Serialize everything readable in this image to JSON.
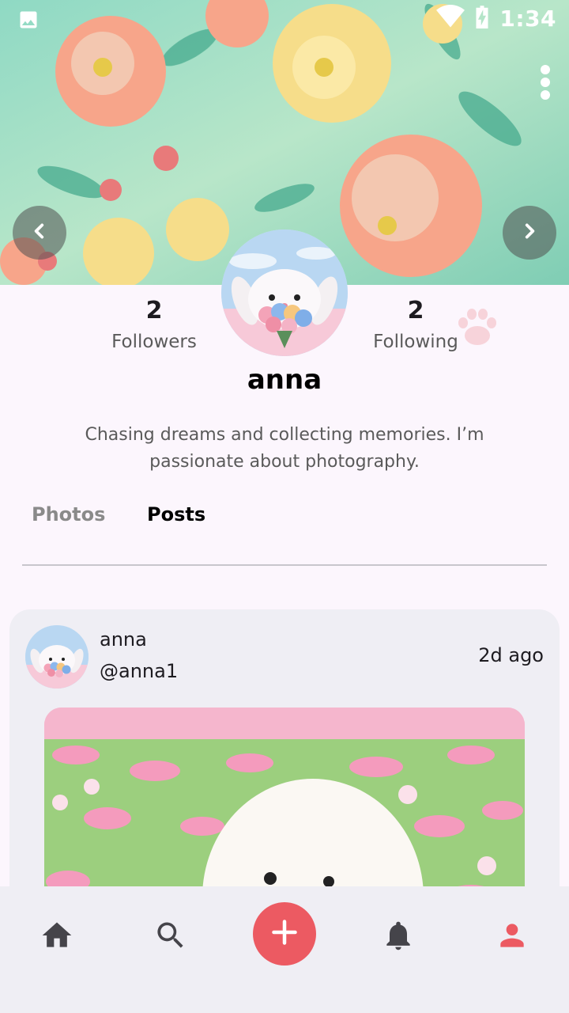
{
  "status_bar": {
    "time": "1:34",
    "icons": [
      "image-icon",
      "wifi-icon",
      "battery-charging-icon"
    ]
  },
  "cover": {
    "prev_icon": "chevron-left-icon",
    "next_icon": "chevron-right-icon",
    "menu_icon": "more-vert-icon"
  },
  "profile": {
    "followers_count": "2",
    "followers_label": "Followers",
    "following_count": "2",
    "following_label": "Following",
    "username": "anna",
    "bio": "Chasing dreams and collecting memories. I’m passionate about photography."
  },
  "tabs": [
    {
      "label": "Photos",
      "selected": false
    },
    {
      "label": "Posts",
      "selected": true
    }
  ],
  "post": {
    "author_name": "anna",
    "author_handle": "@anna1",
    "time": "2d ago"
  },
  "bottom_nav": {
    "items": [
      {
        "icon": "home-icon",
        "selected": false
      },
      {
        "icon": "search-icon",
        "selected": false
      },
      {
        "icon": "add-icon",
        "selected": false
      },
      {
        "icon": "bell-icon",
        "selected": false
      },
      {
        "icon": "person-icon",
        "selected": true
      }
    ]
  },
  "colors": {
    "accent": "#ec5a62",
    "background": "#fcf6fd",
    "card": "#efeef4",
    "muted_text": "#5a5a5a"
  }
}
